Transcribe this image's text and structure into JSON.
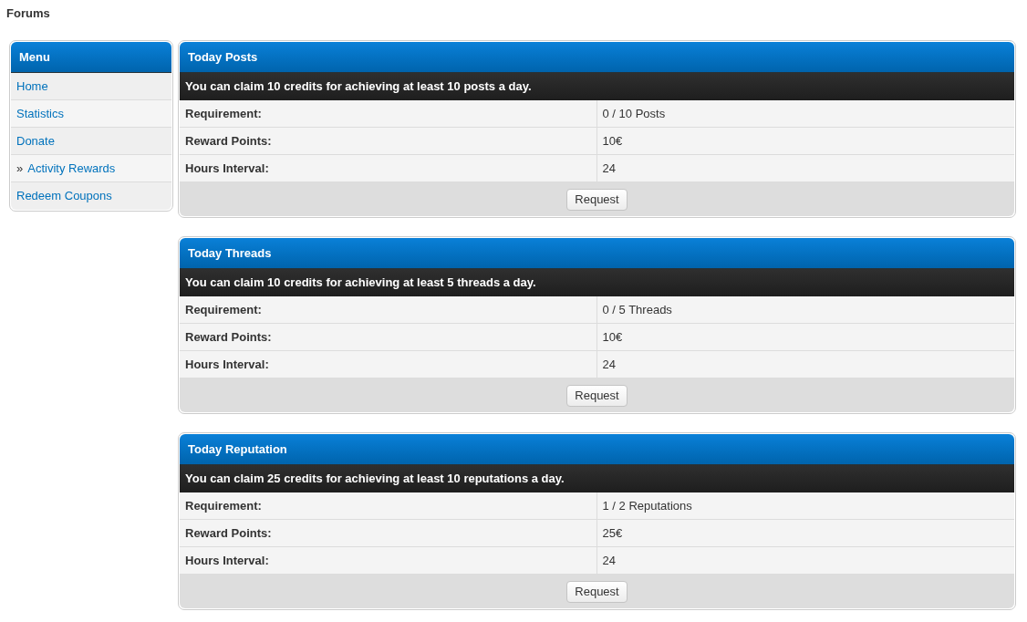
{
  "breadcrumb": "Forums",
  "menu": {
    "title": "Menu",
    "selected_marker": "»",
    "items": [
      {
        "label": "Home",
        "selected": false
      },
      {
        "label": "Statistics",
        "selected": false
      },
      {
        "label": "Donate",
        "selected": false
      },
      {
        "label": "Activity Rewards",
        "selected": true
      },
      {
        "label": "Redeem Coupons",
        "selected": false
      }
    ]
  },
  "panels": [
    {
      "title": "Today Posts",
      "notice": "You can claim 10 credits for achieving at least 10 posts a day.",
      "rows": [
        {
          "label": "Requirement:",
          "value": "0 / 10 Posts"
        },
        {
          "label": "Reward Points:",
          "value": "10€"
        },
        {
          "label": "Hours Interval:",
          "value": "24"
        }
      ],
      "button": "Request"
    },
    {
      "title": "Today Threads",
      "notice": "You can claim 10 credits for achieving at least 5 threads a day.",
      "rows": [
        {
          "label": "Requirement:",
          "value": "0 / 5 Threads"
        },
        {
          "label": "Reward Points:",
          "value": "10€"
        },
        {
          "label": "Hours Interval:",
          "value": "24"
        }
      ],
      "button": "Request"
    },
    {
      "title": "Today Reputation",
      "notice": "You can claim 25 credits for achieving at least 10 reputations a day.",
      "rows": [
        {
          "label": "Requirement:",
          "value": "1 / 2 Reputations"
        },
        {
          "label": "Reward Points:",
          "value": "25€"
        },
        {
          "label": "Hours Interval:",
          "value": "24"
        }
      ],
      "button": "Request"
    }
  ]
}
